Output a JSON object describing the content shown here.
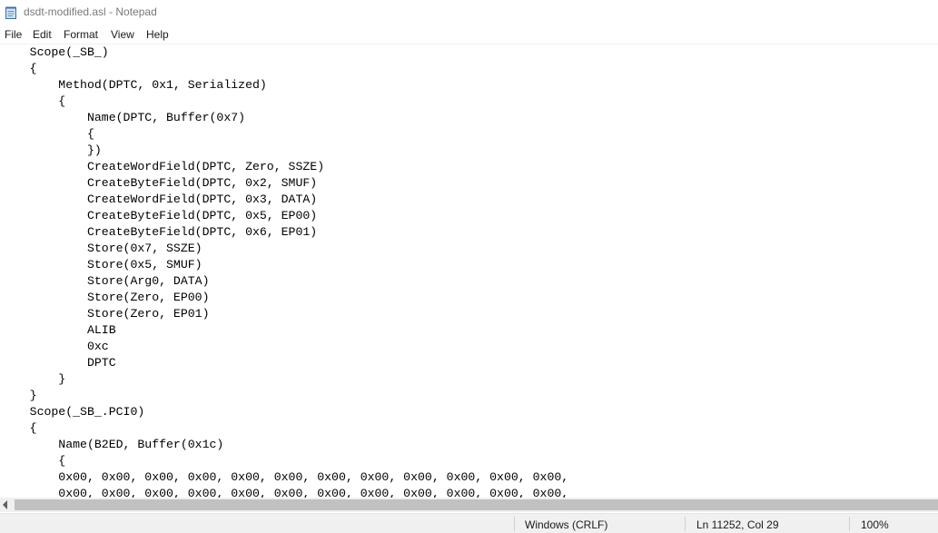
{
  "window": {
    "title": "dsdt-modified.asl - Notepad",
    "icon": "notepad-icon"
  },
  "menu": [
    "File",
    "Edit",
    "Format",
    "View",
    "Help"
  ],
  "editor": {
    "lines": [
      "    Scope(_SB_)",
      "    {",
      "        Method(DPTC, 0x1, Serialized)",
      "        {",
      "            Name(DPTC, Buffer(0x7)",
      "            {",
      "            })",
      "            CreateWordField(DPTC, Zero, SSZE)",
      "            CreateByteField(DPTC, 0x2, SMUF)",
      "            CreateWordField(DPTC, 0x3, DATA)",
      "            CreateByteField(DPTC, 0x5, EP00)",
      "            CreateByteField(DPTC, 0x6, EP01)",
      "            Store(0x7, SSZE)",
      "            Store(0x5, SMUF)",
      "            Store(Arg0, DATA)",
      "            Store(Zero, EP00)",
      "            Store(Zero, EP01)",
      "            ALIB",
      "            0xc",
      "            DPTC",
      "        }",
      "    }",
      "    Scope(_SB_.PCI0)",
      "    {",
      "        Name(B2ED, Buffer(0x1c)",
      "        {",
      "        0x00, 0x00, 0x00, 0x00, 0x00, 0x00, 0x00, 0x00, 0x00, 0x00, 0x00, 0x00,",
      "        0x00, 0x00, 0x00, 0x00, 0x00, 0x00, 0x00, 0x00, 0x00, 0x00, 0x00, 0x00,"
    ]
  },
  "status": {
    "encoding": "Windows (CRLF)",
    "position": "Ln 11252, Col 29",
    "zoom": "100%"
  }
}
